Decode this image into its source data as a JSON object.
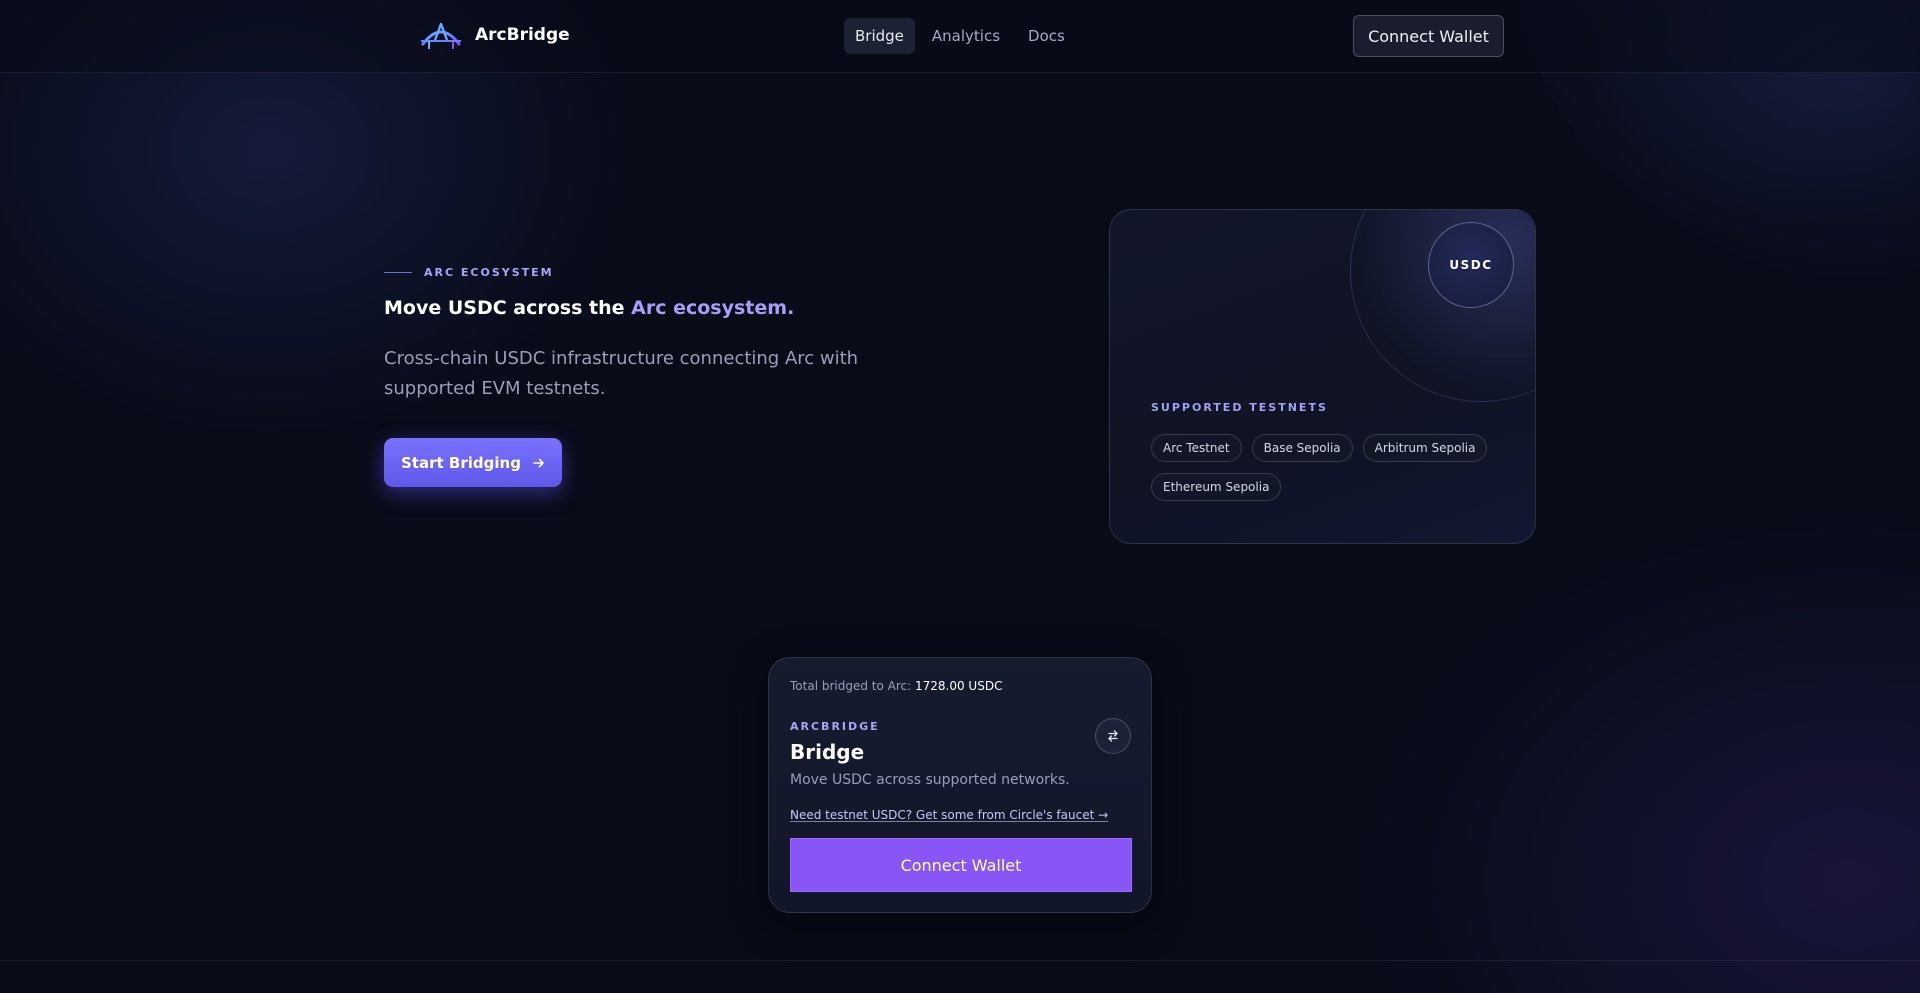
{
  "header": {
    "brand_name": "ArcBridge",
    "logo_icon": "arch-bridge-logo",
    "nav": [
      {
        "label": "Bridge",
        "active": true
      },
      {
        "label": "Analytics",
        "active": false
      },
      {
        "label": "Docs",
        "active": false
      }
    ],
    "connect_label": "Connect Wallet"
  },
  "hero": {
    "eyebrow": "ARC ECOSYSTEM",
    "title_prefix": "Move USDC across the ",
    "title_accent": "Arc ecosystem.",
    "subtitle": "Cross-chain USDC infrastructure connecting Arc with supported EVM testnets.",
    "cta_label": "Start Bridging",
    "cta_icon": "arrow-right-icon"
  },
  "testnets_card": {
    "token_label": "USDC",
    "section_label": "SUPPORTED TESTNETS",
    "chips": [
      "Arc Testnet",
      "Base Sepolia",
      "Arbitrum Sepolia",
      "Ethereum Sepolia"
    ]
  },
  "bridge_card": {
    "total_label": "Total bridged to Arc:",
    "total_value": "1728.00 USDC",
    "eyebrow": "ARCBRIDGE",
    "title": "Bridge",
    "description": "Move USDC across supported networks.",
    "swap_icon": "swap-arrows-icon",
    "faucet_link": "Need testnet USDC? Get some from Circle's faucet →",
    "connect_label": "Connect Wallet"
  },
  "colors": {
    "background": "#080b18",
    "accent": "#a99df8",
    "cta": "#6c64f6",
    "connect_button": "#8855f7"
  }
}
